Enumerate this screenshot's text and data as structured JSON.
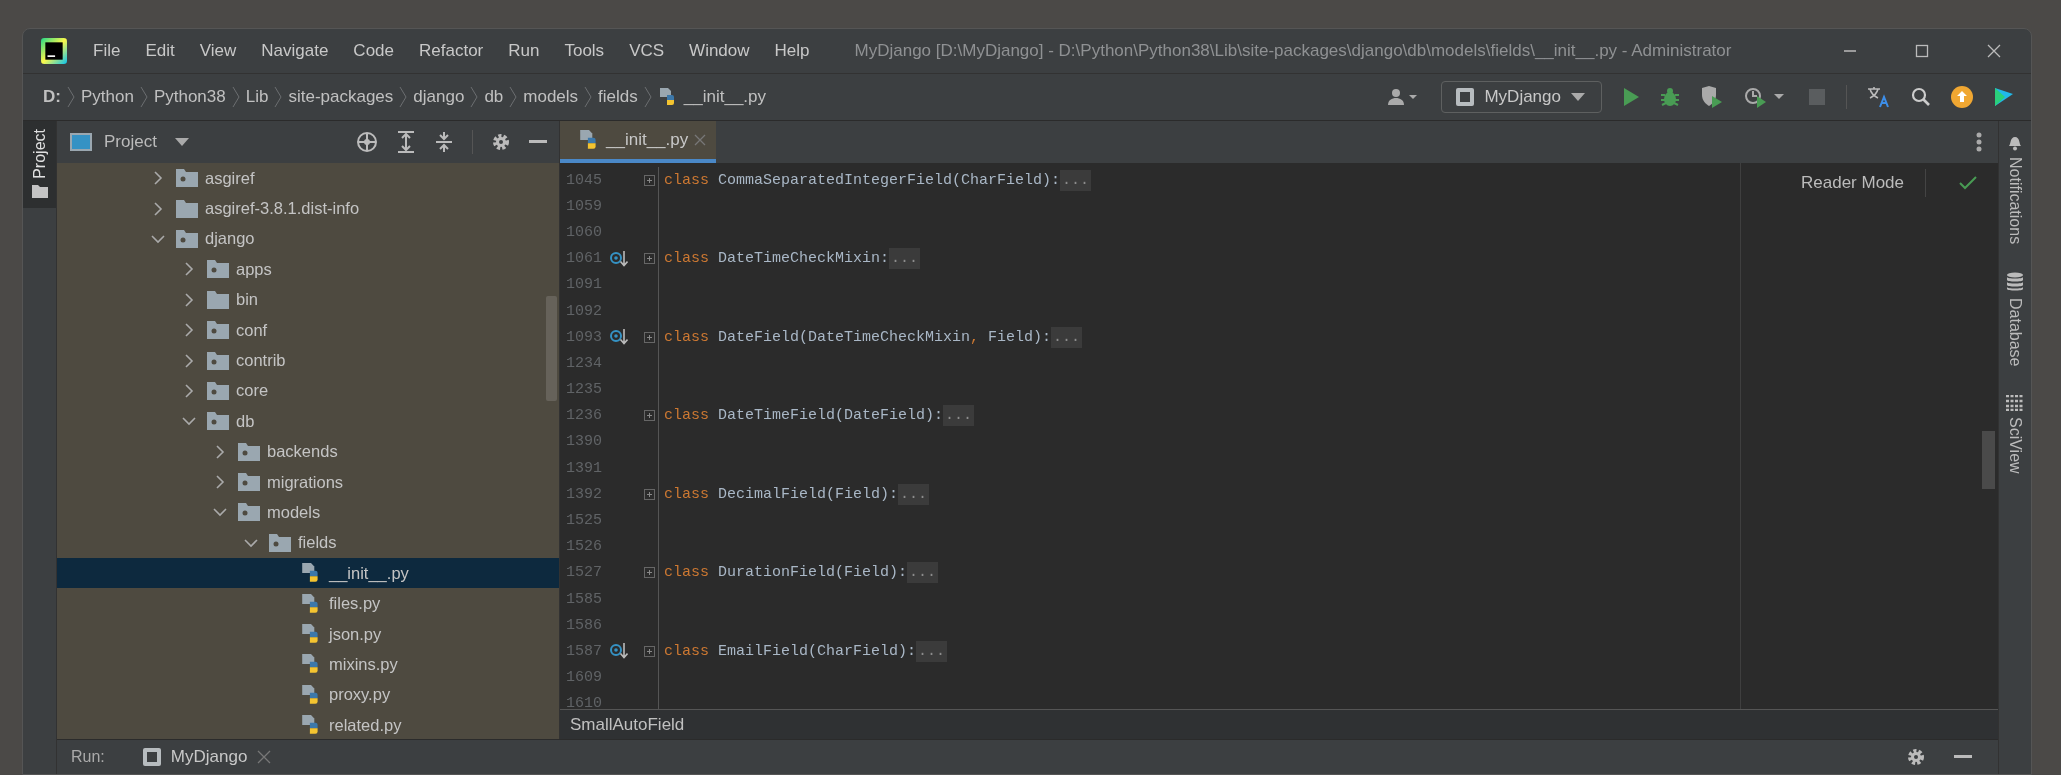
{
  "window": {
    "title": "MyDjango [D:\\MyDjango] - D:\\Python\\Python38\\Lib\\site-packages\\django\\db\\models\\fields\\__init__.py - Administrator"
  },
  "menu": [
    "File",
    "Edit",
    "View",
    "Navigate",
    "Code",
    "Refactor",
    "Run",
    "Tools",
    "VCS",
    "Window",
    "Help"
  ],
  "breadcrumbs": [
    {
      "label": "D:",
      "kind": "drive"
    },
    {
      "label": "Python",
      "kind": "folder"
    },
    {
      "label": "Python38",
      "kind": "folder"
    },
    {
      "label": "Lib",
      "kind": "folder"
    },
    {
      "label": "site-packages",
      "kind": "folder"
    },
    {
      "label": "django",
      "kind": "folder"
    },
    {
      "label": "db",
      "kind": "folder"
    },
    {
      "label": "models",
      "kind": "folder"
    },
    {
      "label": "fields",
      "kind": "folder"
    },
    {
      "label": "__init__.py",
      "kind": "python"
    }
  ],
  "run_config": {
    "label": "MyDjango"
  },
  "left_stripe": [
    {
      "label": "Project",
      "selected": true
    }
  ],
  "project_panel": {
    "title": "Project",
    "tree": [
      {
        "label": "asgiref",
        "kind": "package",
        "expanded": false,
        "selected": false
      },
      {
        "label": "asgiref-3.8.1.dist-info",
        "kind": "folder",
        "expanded": false,
        "selected": false
      },
      {
        "label": "django",
        "kind": "package",
        "expanded": true,
        "selected": false,
        "children": [
          {
            "label": "apps",
            "kind": "package",
            "expanded": false,
            "selected": false
          },
          {
            "label": "bin",
            "kind": "folder",
            "expanded": false,
            "selected": false
          },
          {
            "label": "conf",
            "kind": "package",
            "expanded": false,
            "selected": false
          },
          {
            "label": "contrib",
            "kind": "package",
            "expanded": false,
            "selected": false
          },
          {
            "label": "core",
            "kind": "package",
            "expanded": false,
            "selected": false
          },
          {
            "label": "db",
            "kind": "package",
            "expanded": true,
            "selected": false,
            "children": [
              {
                "label": "backends",
                "kind": "package",
                "expanded": false,
                "selected": false
              },
              {
                "label": "migrations",
                "kind": "package",
                "expanded": false,
                "selected": false
              },
              {
                "label": "models",
                "kind": "package",
                "expanded": true,
                "selected": false,
                "children": [
                  {
                    "label": "fields",
                    "kind": "package",
                    "expanded": true,
                    "selected": false,
                    "children": [
                      {
                        "label": "__init__.py",
                        "kind": "python",
                        "selected": true
                      },
                      {
                        "label": "files.py",
                        "kind": "python",
                        "selected": false
                      },
                      {
                        "label": "json.py",
                        "kind": "python",
                        "selected": false
                      },
                      {
                        "label": "mixins.py",
                        "kind": "python",
                        "selected": false
                      },
                      {
                        "label": "proxy.py",
                        "kind": "python",
                        "selected": false
                      },
                      {
                        "label": "related.py",
                        "kind": "python",
                        "selected": false
                      }
                    ]
                  }
                ]
              }
            ]
          }
        ]
      }
    ]
  },
  "editor": {
    "tabs": [
      {
        "label": "__init__.py",
        "selected": true
      }
    ],
    "lines": [
      {
        "number": "1045",
        "overridden": false,
        "keyword": "class",
        "parts": [
          {
            "text": "CommaSeparatedIntegerField(CharField):",
            "kind": "name"
          }
        ],
        "fold": "..."
      },
      {
        "number": "1059",
        "overridden": false
      },
      {
        "number": "1060",
        "overridden": false
      },
      {
        "number": "1061",
        "overridden": true,
        "keyword": "class",
        "parts": [
          {
            "text": "DateTimeCheckMixin:",
            "kind": "name"
          }
        ],
        "fold": "..."
      },
      {
        "number": "1091",
        "overridden": false
      },
      {
        "number": "1092",
        "overridden": false
      },
      {
        "number": "1093",
        "overridden": true,
        "keyword": "class",
        "parts": [
          {
            "text": "DateField(DateTimeCheckMixin",
            "kind": "name"
          },
          {
            "text": ",",
            "kind": "punct"
          },
          {
            "text": " Field):",
            "kind": "name"
          }
        ],
        "fold": "..."
      },
      {
        "number": "1234",
        "overridden": false
      },
      {
        "number": "1235",
        "overridden": false
      },
      {
        "number": "1236",
        "overridden": false,
        "keyword": "class",
        "parts": [
          {
            "text": "DateTimeField(DateField):",
            "kind": "name"
          }
        ],
        "fold": "..."
      },
      {
        "number": "1390",
        "overridden": false
      },
      {
        "number": "1391",
        "overridden": false
      },
      {
        "number": "1392",
        "overridden": false,
        "keyword": "class",
        "parts": [
          {
            "text": "DecimalField(Field):",
            "kind": "name"
          }
        ],
        "fold": "..."
      },
      {
        "number": "1525",
        "overridden": false
      },
      {
        "number": "1526",
        "overridden": false
      },
      {
        "number": "1527",
        "overridden": false,
        "keyword": "class",
        "parts": [
          {
            "text": "DurationField(Field):",
            "kind": "name"
          }
        ],
        "fold": "..."
      },
      {
        "number": "1585",
        "overridden": false
      },
      {
        "number": "1586",
        "overridden": false
      },
      {
        "number": "1587",
        "overridden": true,
        "keyword": "class",
        "parts": [
          {
            "text": "EmailField(CharField):",
            "kind": "name"
          }
        ],
        "fold": "..."
      },
      {
        "number": "1609",
        "overridden": false
      },
      {
        "number": "1610",
        "overridden": false
      }
    ],
    "reader_mode": "Reader Mode",
    "breadcrumb": "SmallAutoField"
  },
  "right_stripe": [
    {
      "label": "Notifications",
      "kind": "bell"
    },
    {
      "label": "Database",
      "kind": "database"
    },
    {
      "label": "SciView",
      "kind": "grid"
    }
  ],
  "run_bar": {
    "label": "Run:",
    "tabs": [
      {
        "label": "MyDjango"
      }
    ]
  }
}
